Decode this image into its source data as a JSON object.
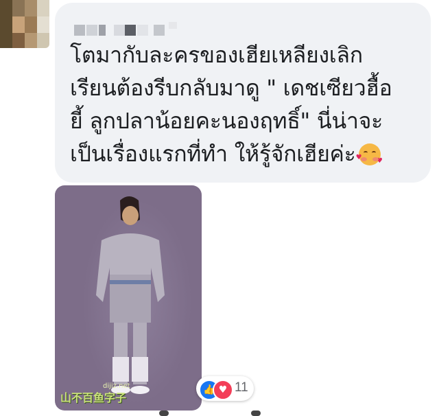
{
  "comment": {
    "lines": [
      "โตมากับละครของเฮียเหลียงเลิก",
      "เรียนต้องรีบกลับมาดู \" เดชเซียวฮื้อ",
      "ยี้ ลูกปลาน้อยคะนองฤทธิ์\" นี่น่าจะ",
      "เป็นเรื่องแรกที่ทำ ให้รู้จักเฮียค่ะ"
    ],
    "emoji": "smiling-face-with-hearts"
  },
  "photo": {
    "watermark": "山不百鱼字子",
    "watermark_small": "dijiz.net"
  },
  "reactions": {
    "count": "11",
    "types": [
      "like",
      "love"
    ]
  },
  "colors": {
    "bubble": "#f0f2f5",
    "like": "#1877f2",
    "love": "#f33e58",
    "text": "#1c1e21"
  }
}
